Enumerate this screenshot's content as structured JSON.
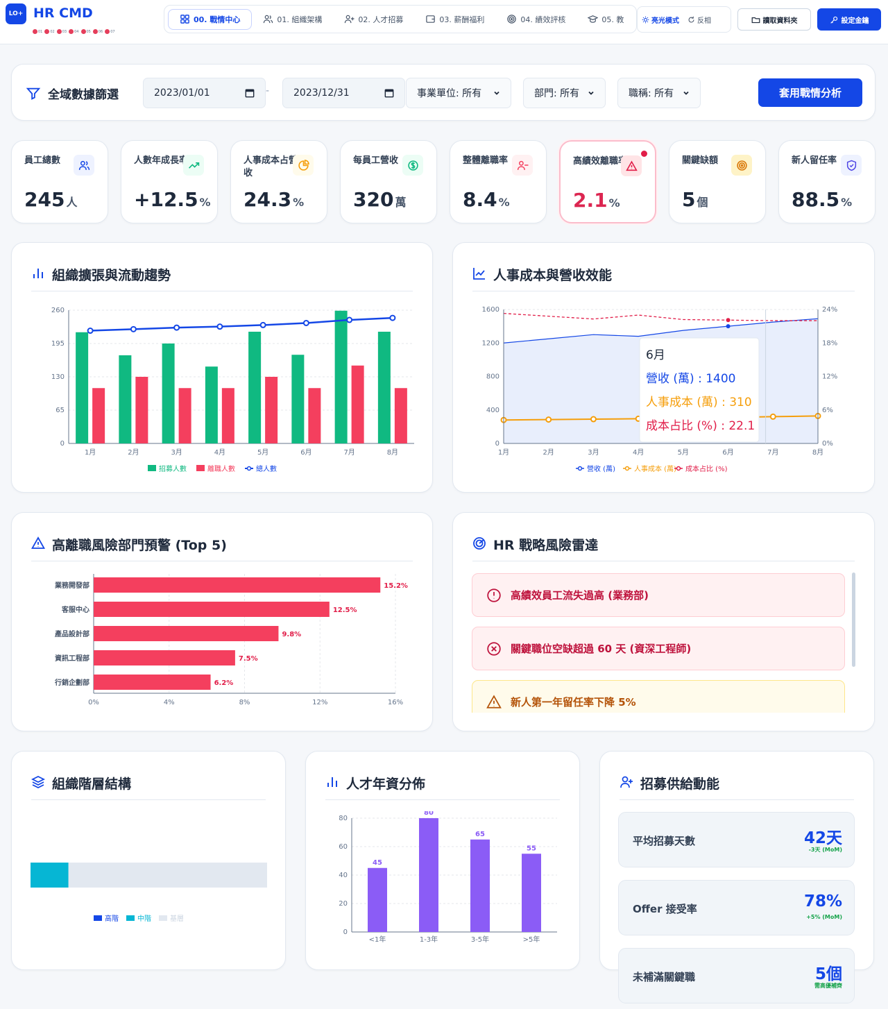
{
  "app": {
    "logo_badge": "LO+",
    "title": "HR CMD",
    "dots": [
      "01",
      "02",
      "03",
      "04",
      "05",
      "06",
      "07"
    ]
  },
  "tabs": [
    "00. 戰情中心",
    "01. 組織架構",
    "02. 人才招募",
    "03. 薪酬福利",
    "04. 績效評核",
    "05. 教"
  ],
  "theme": {
    "light": "亮光模式",
    "dark": "反相"
  },
  "actions": {
    "read_folder": "讀取資料夾",
    "settings": "設定金鑰"
  },
  "filter": {
    "title": "全域數據篩選",
    "date_from": "2023/01/01",
    "date_to": "2023/12/31",
    "dash": "-",
    "unit": "事業單位: 所有",
    "dept": "部門: 所有",
    "position": "職稱: 所有",
    "apply": "套用戰情分析"
  },
  "kpis": [
    {
      "label": "員工總數",
      "value": "245",
      "unit": "人"
    },
    {
      "label": "人數年成長率",
      "value": "+12.5",
      "unit": "%"
    },
    {
      "label": "人事成本占營收",
      "value": "24.3",
      "unit": "%"
    },
    {
      "label": "每員工營收",
      "value": "320",
      "unit": "萬"
    },
    {
      "label": "整體離職率",
      "value": "8.4",
      "unit": "%"
    },
    {
      "label": "高績效離職率",
      "value": "2.1",
      "unit": "%"
    },
    {
      "label": "關鍵缺額",
      "value": "5",
      "unit": "個"
    },
    {
      "label": "新人留任率",
      "value": "88.5",
      "unit": "%"
    }
  ],
  "titles": {
    "org_trend": "組織擴張與流動趨勢",
    "cost": "人事成本與營收效能",
    "risk_dept": "高離職風險部門預警 (Top 5)",
    "radar": "HR 戰略風險雷達",
    "org_level": "組織階層結構",
    "tenure": "人才年資分佈",
    "recruit": "招募供給動能"
  },
  "chart_data": [
    {
      "type": "bar",
      "categories": [
        "1月",
        "2月",
        "3月",
        "4月",
        "5月",
        "6月",
        "7月",
        "8月"
      ],
      "series": [
        {
          "name": "招募人數",
          "values": [
            217,
            172,
            195,
            150,
            218,
            173,
            259,
            218
          ]
        },
        {
          "name": "離職人數",
          "values": [
            108,
            130,
            108,
            108,
            130,
            108,
            152,
            108
          ]
        },
        {
          "name": "總人數",
          "values": [
            220,
            223,
            226,
            228,
            231,
            235,
            241,
            245
          ]
        }
      ],
      "ylim": [
        0,
        260
      ],
      "yticks": [
        "0",
        "65",
        "130",
        "195",
        "260"
      ]
    },
    {
      "type": "line",
      "categories": [
        "1月",
        "2月",
        "3月",
        "4月",
        "5月",
        "6月",
        "7月",
        "8月"
      ],
      "series": [
        {
          "name": "營收 (萬)",
          "values": [
            1200,
            1250,
            1300,
            1280,
            1350,
            1400,
            1450,
            1490
          ]
        },
        {
          "name": "人事成本 (萬)",
          "values": [
            280,
            285,
            290,
            295,
            300,
            310,
            320,
            328
          ]
        },
        {
          "name": "成本占比 (%)",
          "values": [
            23.3,
            22.8,
            22.3,
            23.0,
            22.2,
            22.1,
            22.0,
            22.0
          ]
        }
      ],
      "ylim": [
        0,
        1600
      ],
      "y2lim": [
        0,
        24
      ],
      "yticks": [
        "0",
        "400",
        "800",
        "1200",
        "1600"
      ],
      "y2ticks": [
        "0%",
        "6%",
        "12%",
        "18%",
        "24%"
      ],
      "tooltip": {
        "title": "6月",
        "rows": [
          "營收 (萬) : 1400",
          "人事成本 (萬) : 310",
          "成本占比 (%) : 22.1"
        ]
      }
    },
    {
      "type": "bar",
      "categories": [
        "業務開發部",
        "客服中心",
        "產品設計部",
        "資訊工程部",
        "行銷企劃部"
      ],
      "values": [
        15.2,
        12.5,
        9.8,
        7.5,
        6.2
      ],
      "labels": [
        "15.2%",
        "12.5%",
        "9.8%",
        "7.5%",
        "6.2%"
      ],
      "xlim": [
        0,
        16
      ],
      "xticks": [
        "0%",
        "4%",
        "8%",
        "12%",
        "16%"
      ]
    },
    {
      "type": "bar",
      "categories": [
        "<1年",
        "1-3年",
        "3-5年",
        ">5年"
      ],
      "values": [
        45,
        80,
        65,
        55
      ],
      "ylim": [
        0,
        80
      ],
      "yticks": [
        "0",
        "20",
        "40",
        "60",
        "80"
      ]
    },
    {
      "type": "bar",
      "series": [
        {
          "name": "高階"
        },
        {
          "name": "中階",
          "value": 0.16
        },
        {
          "name": "基層"
        }
      ]
    }
  ],
  "risks": [
    {
      "type": "red",
      "text": "高績效員工流失過高 (業務部)"
    },
    {
      "type": "red",
      "text": "關鍵職位空缺超過 60 天 (資深工程師)"
    },
    {
      "type": "amber",
      "text": "新人第一年留任率下降 5%"
    }
  ],
  "metrics": [
    {
      "label": "平均招募天數",
      "value": "42天",
      "sub": "-3天 (MoM)"
    },
    {
      "label": "Offer 接受率",
      "value": "78%",
      "sub": "+5% (MoM)"
    },
    {
      "label": "未補滿關鍵職",
      "value": "5個",
      "sub": "需高優補齊"
    }
  ],
  "colors": {
    "blue": "#1447e6",
    "green": "#10b981",
    "red": "#f43f5e",
    "amber": "#f59e0b",
    "purple": "#8b5cf6",
    "cyan": "#06b6d4"
  }
}
